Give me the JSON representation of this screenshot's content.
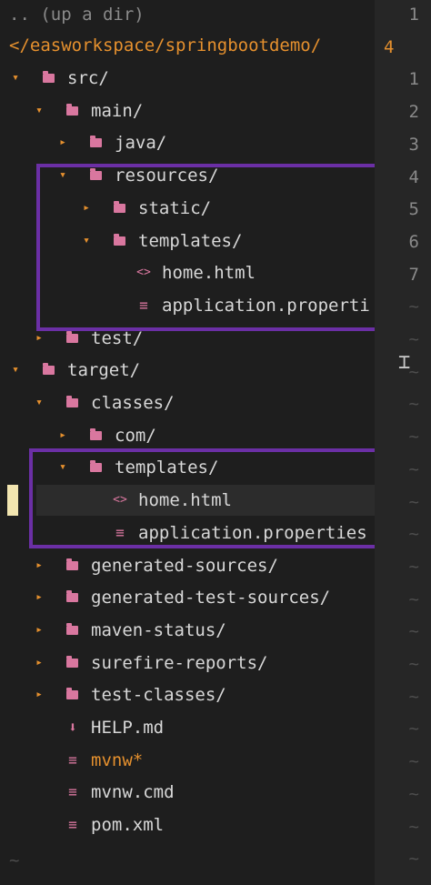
{
  "explorer": {
    "up_dir": ".. (up a dir)",
    "root_path": "</easworkspace/springbootdemo/",
    "items": [
      {
        "label": "src/",
        "type": "folder",
        "expanded": true
      },
      {
        "label": "main/",
        "type": "folder",
        "expanded": true
      },
      {
        "label": "java/",
        "type": "folder",
        "expanded": false
      },
      {
        "label": "resources/",
        "type": "folder",
        "expanded": true
      },
      {
        "label": "static/",
        "type": "folder",
        "expanded": false
      },
      {
        "label": "templates/",
        "type": "folder",
        "expanded": true
      },
      {
        "label": "home.html",
        "type": "html"
      },
      {
        "label": "application.properti",
        "type": "text"
      },
      {
        "label": "test/",
        "type": "folder",
        "expanded": false
      },
      {
        "label": "target/",
        "type": "folder",
        "expanded": true
      },
      {
        "label": "classes/",
        "type": "folder",
        "expanded": true
      },
      {
        "label": "com/",
        "type": "folder",
        "expanded": false
      },
      {
        "label": "templates/",
        "type": "folder",
        "expanded": true
      },
      {
        "label": "home.html",
        "type": "html",
        "selected": true
      },
      {
        "label": "application.properties",
        "type": "text"
      },
      {
        "label": "generated-sources/",
        "type": "folder",
        "expanded": false
      },
      {
        "label": "generated-test-sources/",
        "type": "folder",
        "expanded": false
      },
      {
        "label": "maven-status/",
        "type": "folder",
        "expanded": false
      },
      {
        "label": "surefire-reports/",
        "type": "folder",
        "expanded": false
      },
      {
        "label": "test-classes/",
        "type": "folder",
        "expanded": false
      },
      {
        "label": "HELP.md",
        "type": "download"
      },
      {
        "label": "mvnw*",
        "type": "text",
        "executable": true
      },
      {
        "label": "mvnw.cmd",
        "type": "text"
      },
      {
        "label": "pom.xml",
        "type": "text"
      }
    ],
    "empty_marker": "~"
  },
  "gutter": {
    "line_numbers": [
      "1",
      "4",
      "1",
      "2",
      "3",
      "4",
      "5",
      "6",
      "7"
    ],
    "current_line": "4",
    "tilde": "~"
  },
  "icons": {
    "collapsed": "▸",
    "expanded": "▾",
    "folder": "folder-icon",
    "html": "<>",
    "text": "≡",
    "download": "⬇"
  },
  "colors": {
    "background": "#1e1e1e",
    "arrow": "#e5902e",
    "folder": "#d9779f",
    "highlight_box": "#6b2fa5",
    "cursor": "#f2e5b0"
  }
}
